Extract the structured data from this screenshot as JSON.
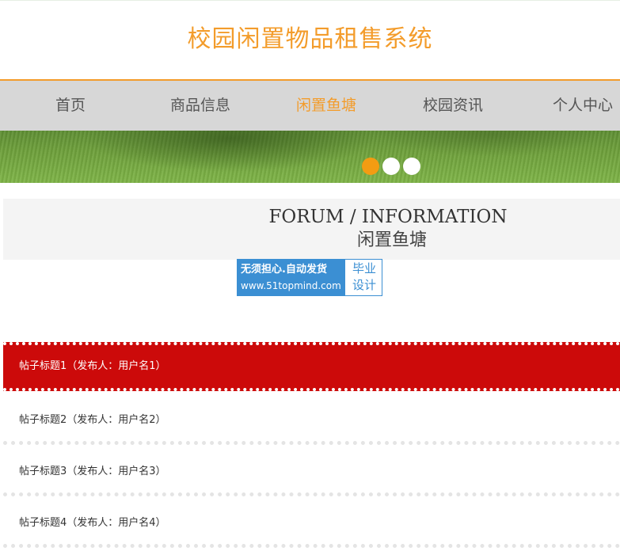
{
  "header": {
    "site_title": "校园闲置物品租售系统"
  },
  "nav": {
    "items": [
      {
        "label": "首页"
      },
      {
        "label": "商品信息"
      },
      {
        "label": "闲置鱼塘"
      },
      {
        "label": "校园资讯"
      },
      {
        "label": "个人中心"
      }
    ],
    "active_index": 2
  },
  "carousel": {
    "slide_count": 3,
    "active_index": 0
  },
  "section": {
    "title_en": "FORUM / INFORMATION",
    "title_cn": "闲置鱼塘"
  },
  "watermark": {
    "line1": "无须担心.自动发货",
    "line2": "www.51topmind.com",
    "right_top": "毕业",
    "right_bottom": "设计"
  },
  "posts": [
    {
      "label": "帖子标题1（发布人：用户名1）"
    },
    {
      "label": "帖子标题2（发布人：用户名2）"
    },
    {
      "label": "帖子标题3（发布人：用户名3）"
    },
    {
      "label": "帖子标题4（发布人：用户名4）"
    }
  ],
  "colors": {
    "accent": "#f39c2b",
    "nav_bg": "#d7d7d7",
    "active_post_bg": "#cc0a0a",
    "watermark_blue": "#3b8fd3"
  }
}
